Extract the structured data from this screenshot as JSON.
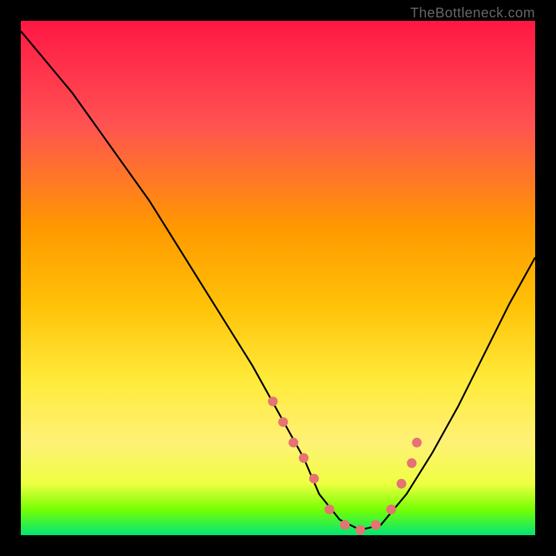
{
  "watermark": "TheBottleneck.com",
  "chart_data": {
    "type": "line",
    "title": "",
    "xlabel": "",
    "ylabel": "",
    "xlim": [
      0,
      100
    ],
    "ylim": [
      0,
      100
    ],
    "gradient_stops": [
      {
        "offset": 0,
        "color": "#ff1744"
      },
      {
        "offset": 20,
        "color": "#ff5252"
      },
      {
        "offset": 40,
        "color": "#ff9800"
      },
      {
        "offset": 55,
        "color": "#ffc107"
      },
      {
        "offset": 70,
        "color": "#ffeb3b"
      },
      {
        "offset": 82,
        "color": "#fff176"
      },
      {
        "offset": 90,
        "color": "#eeff41"
      },
      {
        "offset": 95,
        "color": "#76ff03"
      },
      {
        "offset": 100,
        "color": "#00e676"
      }
    ],
    "series": [
      {
        "name": "bottleneck-curve",
        "x": [
          0,
          5,
          10,
          15,
          20,
          25,
          30,
          35,
          40,
          45,
          50,
          55,
          58,
          62,
          66,
          70,
          75,
          80,
          85,
          90,
          95,
          100
        ],
        "y": [
          98,
          92,
          86,
          79,
          72,
          65,
          57,
          49,
          41,
          33,
          24,
          15,
          8,
          3,
          1,
          2,
          8,
          16,
          25,
          35,
          45,
          54
        ]
      }
    ],
    "markers": {
      "name": "highlight-points",
      "color": "#e57373",
      "x": [
        49,
        51,
        53,
        55,
        57,
        60,
        63,
        66,
        69,
        72,
        74,
        76,
        77
      ],
      "y": [
        26,
        22,
        18,
        15,
        11,
        5,
        2,
        1,
        2,
        5,
        10,
        14,
        18
      ]
    }
  }
}
